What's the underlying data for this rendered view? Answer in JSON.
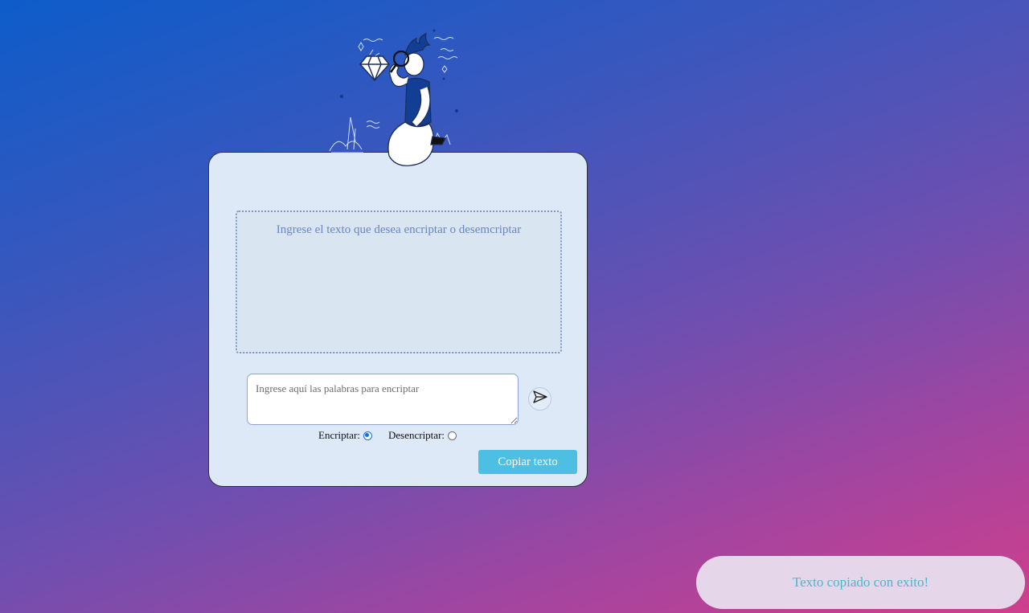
{
  "main": {
    "output_placeholder": "Ingrese el texto que desea encriptar o desemcriptar",
    "input_placeholder": "Ingrese aquí las palabras para encriptar",
    "input_value": "",
    "radio_encrypt_label": "Encriptar:",
    "radio_decrypt_label": "Desencriptar:",
    "selected_mode": "Encriptar",
    "copy_button_label": "Copiar texto",
    "send_icon": "paper-plane-icon"
  },
  "toast": {
    "message": "Texto copiado con exito!"
  },
  "colors": {
    "background_start": "#0d5cc9",
    "background_end": "#cf3f8c",
    "card": "#dde9f6",
    "accent_button": "#4cbfe3",
    "toast_bg": "#e6d6ea",
    "toast_text": "#47b8c9"
  }
}
